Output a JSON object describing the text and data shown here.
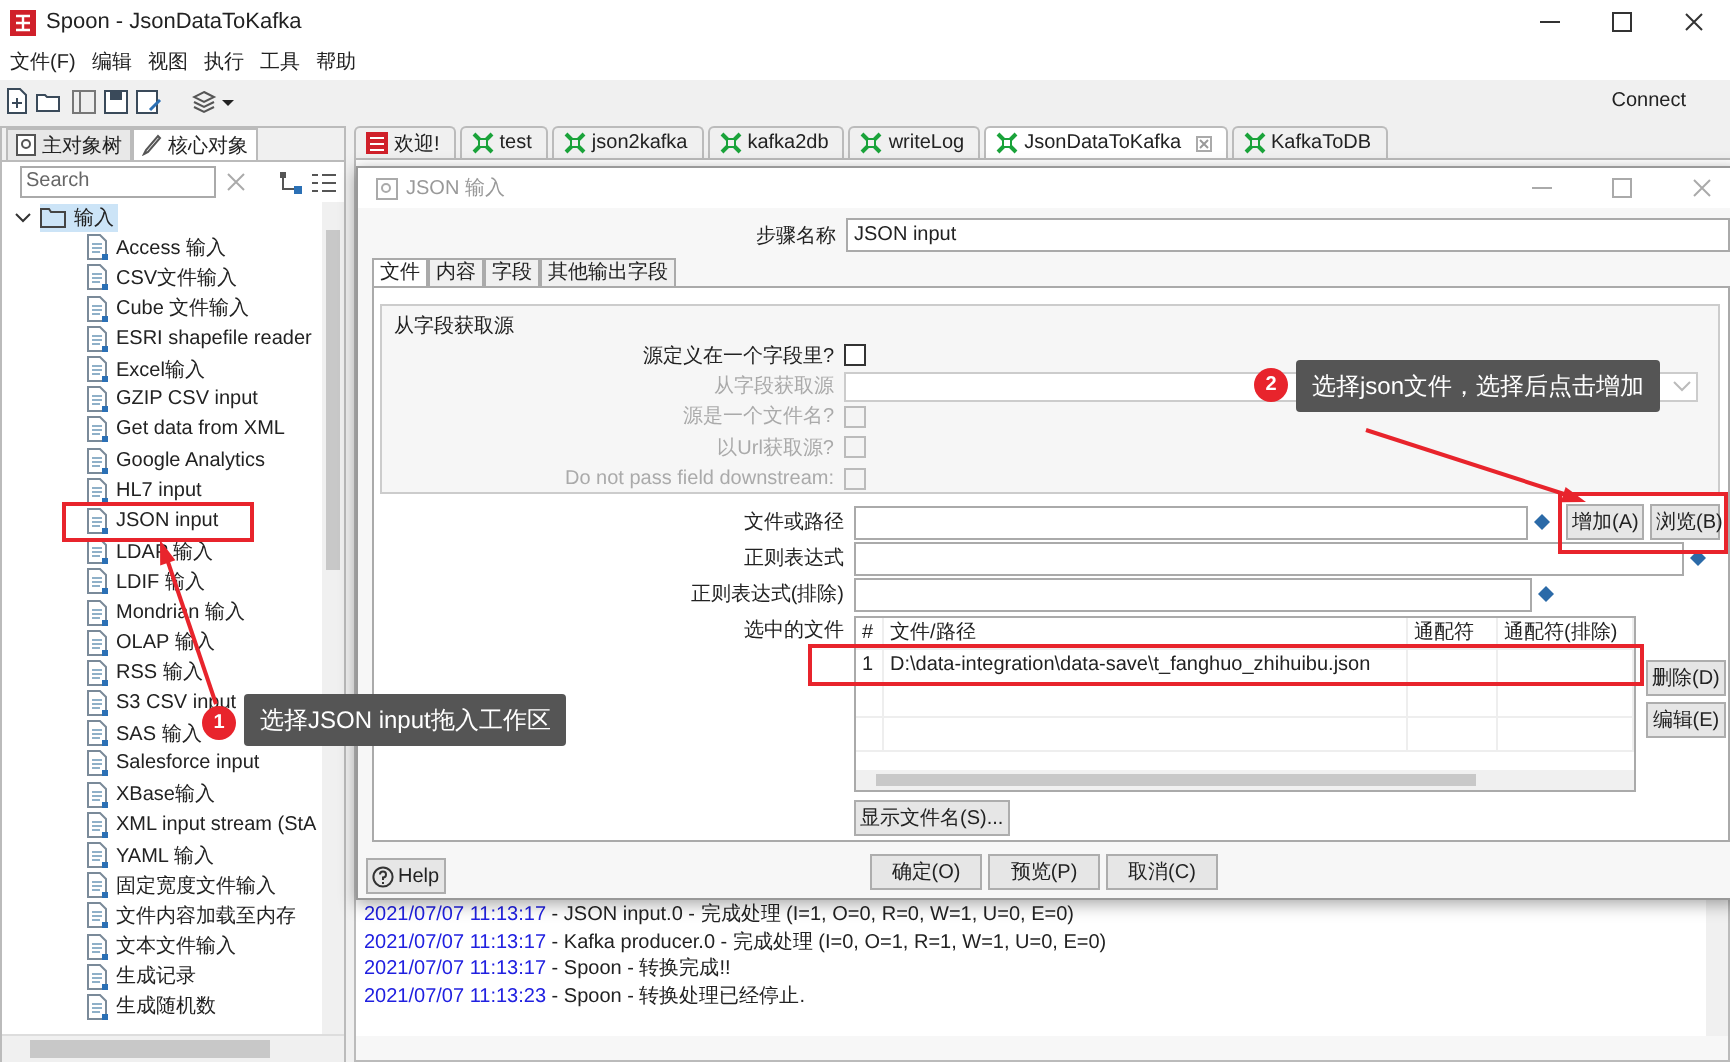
{
  "window": {
    "title": "Spoon - JsonDataToKafka"
  },
  "menu": [
    "文件(F)",
    "编辑",
    "视图",
    "执行",
    "工具",
    "帮助"
  ],
  "toolbar": {
    "connect": "Connect"
  },
  "left_panel": {
    "tabs": [
      {
        "label": "主对象树",
        "selected": false
      },
      {
        "label": "核心对象",
        "selected": true
      }
    ],
    "search": {
      "placeholder": "Search"
    },
    "tree": [
      {
        "label": "输入",
        "expanded": true,
        "selected": true,
        "children": [
          {
            "label": "Access 输入",
            "selected": false
          },
          {
            "label": "CSV文件输入",
            "selected": false
          },
          {
            "label": "Cube 文件输入",
            "selected": false
          },
          {
            "label": "ESRI shapefile reader",
            "selected": false
          },
          {
            "label": "Excel输入",
            "selected": false
          },
          {
            "label": "GZIP CSV input",
            "selected": false
          },
          {
            "label": "Get data from XML",
            "selected": false
          },
          {
            "label": "Google Analytics",
            "selected": false
          },
          {
            "label": "HL7 input",
            "selected": false
          },
          {
            "label": "JSON input",
            "selected": false
          },
          {
            "label": "LDAP 输入",
            "selected": false
          },
          {
            "label": "LDIF 输入",
            "selected": false
          },
          {
            "label": "Mondrian 输入",
            "selected": false
          },
          {
            "label": "OLAP 输入",
            "selected": false
          },
          {
            "label": "RSS 输入",
            "selected": false
          },
          {
            "label": "S3 CSV input",
            "selected": false
          },
          {
            "label": "SAS 输入",
            "selected": false
          },
          {
            "label": "Salesforce input",
            "selected": false
          },
          {
            "label": "XBase输入",
            "selected": false
          },
          {
            "label": "XML input stream (StA",
            "selected": false
          },
          {
            "label": "YAML 输入",
            "selected": false
          },
          {
            "label": "固定宽度文件输入",
            "selected": false
          },
          {
            "label": "文件内容加载至内存",
            "selected": false
          },
          {
            "label": "文本文件输入",
            "selected": false
          },
          {
            "label": "生成记录",
            "selected": false
          },
          {
            "label": "生成随机数",
            "selected": false
          }
        ]
      }
    ]
  },
  "editor_tabs": [
    {
      "label": "欢迎!",
      "kind": "welcome",
      "selected": false
    },
    {
      "label": "test",
      "kind": "transformation",
      "selected": false
    },
    {
      "label": "json2kafka",
      "kind": "transformation",
      "selected": false
    },
    {
      "label": "kafka2db",
      "kind": "transformation",
      "selected": false
    },
    {
      "label": "writeLog",
      "kind": "transformation",
      "selected": false
    },
    {
      "label": "JsonDataToKafka",
      "kind": "transformation",
      "selected": true
    },
    {
      "label": "KafkaToDB",
      "kind": "transformation",
      "selected": false
    }
  ],
  "log": [
    {
      "time": "2021/07/07 11:13:17",
      "message": "- JSON input.0 - 完成处理 (I=1, O=0, R=0, W=1, U=0, E=0)"
    },
    {
      "time": "2021/07/07 11:13:17",
      "message": "- Kafka producer.0 - 完成处理 (I=0, O=1, R=1, W=1, U=0, E=0)"
    },
    {
      "time": "2021/07/07 11:13:17",
      "message": "- Spoon - 转换完成!!"
    },
    {
      "time": "2021/07/07 11:13:23",
      "message": "- Spoon - 转换处理已经停止."
    }
  ],
  "dialog": {
    "title": "JSON 输入",
    "step_name": {
      "label": "步骤名称",
      "value": "JSON input"
    },
    "tabs": [
      {
        "label": "文件",
        "selected": true
      },
      {
        "label": "内容",
        "selected": false
      },
      {
        "label": "字段",
        "selected": false
      },
      {
        "label": "其他输出字段",
        "selected": false
      }
    ],
    "source_group": {
      "title": "从字段获取源",
      "rows": [
        {
          "kind": "checkbox",
          "label": "源定义在一个字段里?",
          "checked": false,
          "disabled": false
        },
        {
          "kind": "select",
          "label": "从字段获取源",
          "disabled": true
        },
        {
          "kind": "checkbox",
          "label": "源是一个文件名?",
          "checked": false,
          "disabled": true
        },
        {
          "kind": "checkbox",
          "label": "以Url获取源?",
          "checked": false,
          "disabled": true
        },
        {
          "kind": "checkbox",
          "label": "Do not pass field downstream:",
          "checked": false,
          "disabled": true
        }
      ]
    },
    "file_inputs": [
      {
        "label": "文件或路径",
        "kind": "with_buttons"
      },
      {
        "label": "正则表达式",
        "kind": "wide"
      },
      {
        "label": "正则表达式(排除)",
        "kind": "short"
      }
    ],
    "file_buttons": [
      "增加(A)",
      "浏览(B)"
    ],
    "files_table": {
      "label": "选中的文件",
      "columns": [
        "#",
        "文件/路径",
        "通配符",
        "通配符(排除)"
      ],
      "rows": [
        {
          "number": "1",
          "path": "D:\\data-integration\\data-save\\t_fanghuo_zhihuibu.json"
        }
      ]
    },
    "table_buttons": [
      "删除(D)",
      "编辑(E)"
    ],
    "show_files_button": "显示文件名(S)...",
    "help": "Help",
    "footer_buttons": [
      "确定(O)",
      "预览(P)",
      "取消(C)"
    ]
  },
  "callouts": [
    {
      "number": "1",
      "text": "选择JSON input拖入工作区"
    },
    {
      "number": "2",
      "text": "选择json文件，选择后点击增加"
    }
  ]
}
